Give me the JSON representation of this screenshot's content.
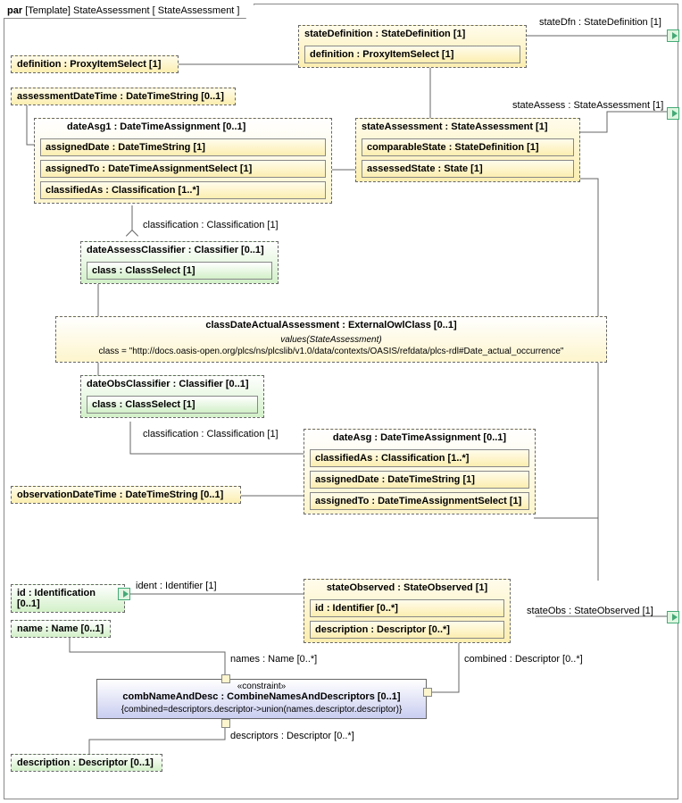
{
  "frame": {
    "kind": "par",
    "stereotype": "[Template]",
    "name": "StateAssessment",
    "context": "[ StateAssessment ]"
  },
  "ports": {
    "stateDfn": "stateDfn : StateDefinition [1]",
    "stateAssess": "stateAssess : StateAssessment [1]",
    "stateObs": "stateObs : StateObserved [1]"
  },
  "boxes": {
    "stateDefinition": {
      "header": "stateDefinition : StateDefinition [1]",
      "items": {
        "definition": "definition : ProxyItemSelect [1]"
      }
    },
    "definition": "definition : ProxyItemSelect [1]",
    "assessmentDateTime": "assessmentDateTime : DateTimeString [0..1]",
    "dateAsg1": {
      "header": "dateAsg1 : DateTimeAssignment [0..1]",
      "items": {
        "assignedDate": "assignedDate : DateTimeString [1]",
        "assignedTo": "assignedTo : DateTimeAssignmentSelect [1]",
        "classifiedAs": "classifiedAs : Classification [1..*]"
      }
    },
    "stateAssessment": {
      "header": "stateAssessment : StateAssessment [1]",
      "items": {
        "comparableState": "comparableState : StateDefinition [1]",
        "assessedState": "assessedState : State [1]"
      }
    },
    "dateAssessClassifier": {
      "header": "dateAssessClassifier : Classifier [0..1]",
      "items": {
        "klass": "class : ClassSelect [1]"
      }
    },
    "classDateActualAssessment": {
      "header": "classDateActualAssessment : ExternalOwlClass [0..1]",
      "note": "values(StateAssessment)",
      "value": "class = \"http://docs.oasis-open.org/plcs/ns/plcslib/v1.0/data/contexts/OASIS/refdata/plcs-rdl#Date_actual_occurrence\""
    },
    "dateObsClassifier": {
      "header": "dateObsClassifier : Classifier [0..1]",
      "items": {
        "klass": "class : ClassSelect [1]"
      }
    },
    "dateAsg": {
      "header": "dateAsg : DateTimeAssignment [0..1]",
      "items": {
        "classifiedAs": "classifiedAs : Classification [1..*]",
        "assignedDate": "assignedDate : DateTimeString [1]",
        "assignedTo": "assignedTo : DateTimeAssignmentSelect [1]"
      }
    },
    "observationDateTime": "observationDateTime : DateTimeString [0..1]",
    "stateObserved": {
      "header": "stateObserved : StateObserved [1]",
      "items": {
        "id": "id : Identifier [0..*]",
        "description": "description : Descriptor [0..*]"
      }
    },
    "id": "id : Identification [0..1]",
    "name": "name : Name [0..1]",
    "combNameAndDesc": {
      "stereo": "«constraint»",
      "header": "combNameAndDesc : CombineNamesAndDescriptors [0..1]",
      "expr": "{combined=descriptors.descriptor->union(names.descriptor.descriptor)}"
    },
    "description": "description : Descriptor [0..1]"
  },
  "labels": {
    "classification1": "classification : Classification [1]",
    "classification2": "classification : Classification [1]",
    "ident": "ident : Identifier [1]",
    "names": "names : Name [0..*]",
    "combined": "combined : Descriptor [0..*]",
    "descriptors": "descriptors : Descriptor [0..*]"
  },
  "chart_data": {
    "type": "parametric-diagram",
    "template": "StateAssessment",
    "properties": [
      {
        "name": "stateDefinition",
        "type": "StateDefinition",
        "mult": "1",
        "children": [
          {
            "name": "definition",
            "type": "ProxyItemSelect",
            "mult": "1"
          }
        ]
      },
      {
        "name": "definition",
        "type": "ProxyItemSelect",
        "mult": "1"
      },
      {
        "name": "assessmentDateTime",
        "type": "DateTimeString",
        "mult": "0..1"
      },
      {
        "name": "dateAsg1",
        "type": "DateTimeAssignment",
        "mult": "0..1",
        "children": [
          {
            "name": "assignedDate",
            "type": "DateTimeString",
            "mult": "1"
          },
          {
            "name": "assignedTo",
            "type": "DateTimeAssignmentSelect",
            "mult": "1"
          },
          {
            "name": "classifiedAs",
            "type": "Classification",
            "mult": "1..*"
          }
        ]
      },
      {
        "name": "stateAssessment",
        "type": "StateAssessment",
        "mult": "1",
        "children": [
          {
            "name": "comparableState",
            "type": "StateDefinition",
            "mult": "1"
          },
          {
            "name": "assessedState",
            "type": "State",
            "mult": "1"
          }
        ]
      },
      {
        "name": "dateAssessClassifier",
        "type": "Classifier",
        "mult": "0..1",
        "children": [
          {
            "name": "class",
            "type": "ClassSelect",
            "mult": "1"
          }
        ]
      },
      {
        "name": "classDateActualAssessment",
        "type": "ExternalOwlClass",
        "mult": "0..1",
        "class": "http://docs.oasis-open.org/plcs/ns/plcslib/v1.0/data/contexts/OASIS/refdata/plcs-rdl#Date_actual_occurrence"
      },
      {
        "name": "dateObsClassifier",
        "type": "Classifier",
        "mult": "0..1",
        "children": [
          {
            "name": "class",
            "type": "ClassSelect",
            "mult": "1"
          }
        ]
      },
      {
        "name": "dateAsg",
        "type": "DateTimeAssignment",
        "mult": "0..1",
        "children": [
          {
            "name": "classifiedAs",
            "type": "Classification",
            "mult": "1..*"
          },
          {
            "name": "assignedDate",
            "type": "DateTimeString",
            "mult": "1"
          },
          {
            "name": "assignedTo",
            "type": "DateTimeAssignmentSelect",
            "mult": "1"
          }
        ]
      },
      {
        "name": "observationDateTime",
        "type": "DateTimeString",
        "mult": "0..1"
      },
      {
        "name": "stateObserved",
        "type": "StateObserved",
        "mult": "1",
        "children": [
          {
            "name": "id",
            "type": "Identifier",
            "mult": "0..*"
          },
          {
            "name": "description",
            "type": "Descriptor",
            "mult": "0..*"
          }
        ]
      },
      {
        "name": "id",
        "type": "Identification",
        "mult": "0..1"
      },
      {
        "name": "name",
        "type": "Name",
        "mult": "0..1"
      },
      {
        "name": "combNameAndDesc",
        "type": "CombineNamesAndDescriptors",
        "mult": "0..1",
        "stereo": "constraint",
        "expr": "combined=descriptors.descriptor->union(names.descriptor.descriptor)"
      },
      {
        "name": "description",
        "type": "Descriptor",
        "mult": "0..1"
      }
    ],
    "ports": [
      {
        "name": "stateDfn",
        "type": "StateDefinition",
        "mult": "1"
      },
      {
        "name": "stateAssess",
        "type": "StateAssessment",
        "mult": "1"
      },
      {
        "name": "stateObs",
        "type": "StateObserved",
        "mult": "1"
      }
    ],
    "connectors": [
      {
        "from": "definition",
        "to": "stateDefinition.definition"
      },
      {
        "from": "assessmentDateTime",
        "to": "dateAsg1.assignedDate"
      },
      {
        "from": "dateAsg1.assignedTo",
        "to": "stateAssessment"
      },
      {
        "from": "dateAsg1.classifiedAs",
        "to": "dateAssessClassifier",
        "role": "classification : Classification [1]"
      },
      {
        "from": "dateAssessClassifier.class",
        "to": "classDateActualAssessment"
      },
      {
        "from": "dateObsClassifier.class",
        "to": "classDateActualAssessment"
      },
      {
        "from": "dateObsClassifier",
        "to": "dateAsg.classifiedAs",
        "role": "classification : Classification [1]"
      },
      {
        "from": "observationDateTime",
        "to": "dateAsg.assignedDate"
      },
      {
        "from": "dateAsg.assignedTo",
        "to": "stateObserved"
      },
      {
        "from": "stateAssessment.assessedState",
        "to": "stateObserved"
      },
      {
        "from": "stateDefinition",
        "to": "stateDfn"
      },
      {
        "from": "stateDefinition",
        "to": "stateAssessment.comparableState"
      },
      {
        "from": "stateAssessment",
        "to": "stateAssess"
      },
      {
        "from": "stateObserved",
        "to": "stateObs"
      },
      {
        "from": "id",
        "to": "stateObserved.id",
        "role": "ident : Identifier [1]"
      },
      {
        "from": "name",
        "to": "combNameAndDesc",
        "role": "names : Name [0..*]"
      },
      {
        "from": "description",
        "to": "combNameAndDesc",
        "role": "descriptors : Descriptor [0..*]"
      },
      {
        "from": "combNameAndDesc",
        "to": "stateObserved.description",
        "role": "combined : Descriptor [0..*]"
      }
    ]
  }
}
